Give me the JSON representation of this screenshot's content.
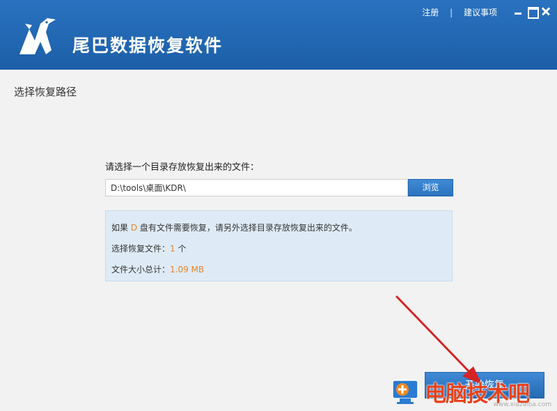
{
  "header": {
    "app_title": "尾巴数据恢复软件",
    "register_link": "注册",
    "separator": "|",
    "suggestion_link": "建议事项"
  },
  "main": {
    "section_title": "选择恢复路径",
    "prompt": "请选择一个目录存放恢复出来的文件：",
    "path_value": "D:\\tools\\桌面\\KDR\\",
    "browse_label": "浏览",
    "info": {
      "line1_prefix": "如果 ",
      "drive": "D",
      "line1_suffix": " 盘有文件需要恢复，请另外选择目录存放恢复出来的文件。",
      "line2_prefix": "选择恢复文件：",
      "file_count": "1",
      "line2_suffix": " 个",
      "line3_prefix": "文件大小总计：",
      "total_size": "1.09 MB"
    }
  },
  "footer": {
    "start_label": "开始恢复"
  },
  "watermark": {
    "text": "电脑技术吧",
    "url": "www.xiazaiba.com"
  },
  "colors": {
    "header_blue": "#1c5fa8",
    "accent_orange": "#e8822a",
    "info_bg": "#deebf6",
    "arrow_red": "#d42424"
  }
}
